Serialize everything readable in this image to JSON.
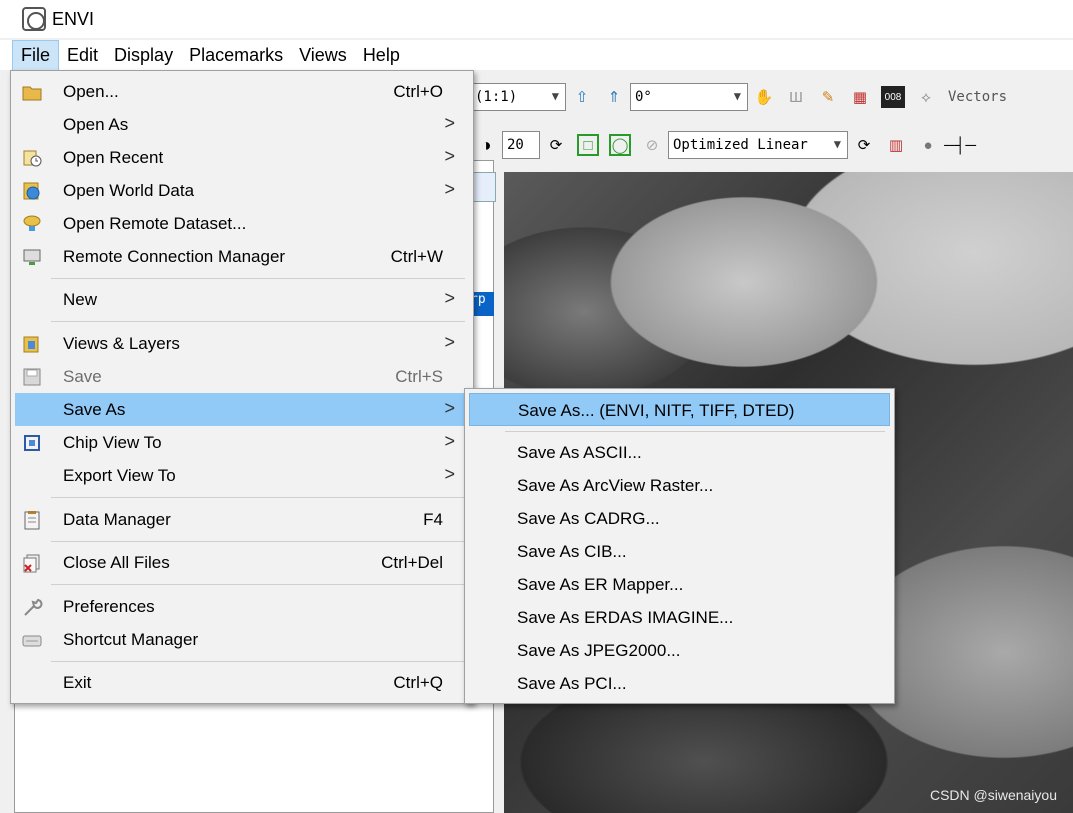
{
  "window": {
    "title": "ENVI",
    "icon": "envi-app-icon"
  },
  "menubar": {
    "items": [
      "File",
      "Edit",
      "Display",
      "Placemarks",
      "Views",
      "Help"
    ],
    "active": "File"
  },
  "toolbar": {
    "zoom_value": "(1:1)",
    "rotation_value": "0°",
    "vectors_label": "Vectors",
    "contrast_value": "20",
    "stretch_value": "Optimized Linear"
  },
  "left_pane": {
    "selected_text": "rp"
  },
  "file_menu": {
    "open": {
      "label": "Open...",
      "shortcut": "Ctrl+O"
    },
    "open_as": {
      "label": "Open As"
    },
    "open_recent": {
      "label": "Open Recent"
    },
    "open_world_data": {
      "label": "Open World Data"
    },
    "open_remote_dataset": {
      "label": "Open Remote Dataset..."
    },
    "remote_connection_manager": {
      "label": "Remote Connection Manager",
      "shortcut": "Ctrl+W"
    },
    "new": {
      "label": "New"
    },
    "views_layers": {
      "label": "Views & Layers"
    },
    "save": {
      "label": "Save",
      "shortcut": "Ctrl+S"
    },
    "save_as": {
      "label": "Save As"
    },
    "chip_view_to": {
      "label": "Chip View To"
    },
    "export_view_to": {
      "label": "Export View To"
    },
    "data_manager": {
      "label": "Data Manager",
      "shortcut": "F4"
    },
    "close_all_files": {
      "label": "Close All Files",
      "shortcut": "Ctrl+Del"
    },
    "preferences": {
      "label": "Preferences"
    },
    "shortcut_manager": {
      "label": "Shortcut Manager"
    },
    "exit": {
      "label": "Exit",
      "shortcut": "Ctrl+Q"
    },
    "submenu_arrow": ">"
  },
  "save_as_submenu": {
    "items": [
      "Save As... (ENVI, NITF, TIFF, DTED)",
      "Save As ASCII...",
      "Save As ArcView Raster...",
      "Save As CADRG...",
      "Save As CIB...",
      "Save As ER Mapper...",
      "Save As ERDAS IMAGINE...",
      "Save As JPEG2000...",
      "Save As PCI..."
    ],
    "highlighted": "Save As... (ENVI, NITF, TIFF, DTED)"
  },
  "watermark": "CSDN @siwenaiyou",
  "colors": {
    "highlight": "#91c9f7",
    "menu_bg": "#f2f2f2",
    "selection_blue": "#0a64c8"
  }
}
